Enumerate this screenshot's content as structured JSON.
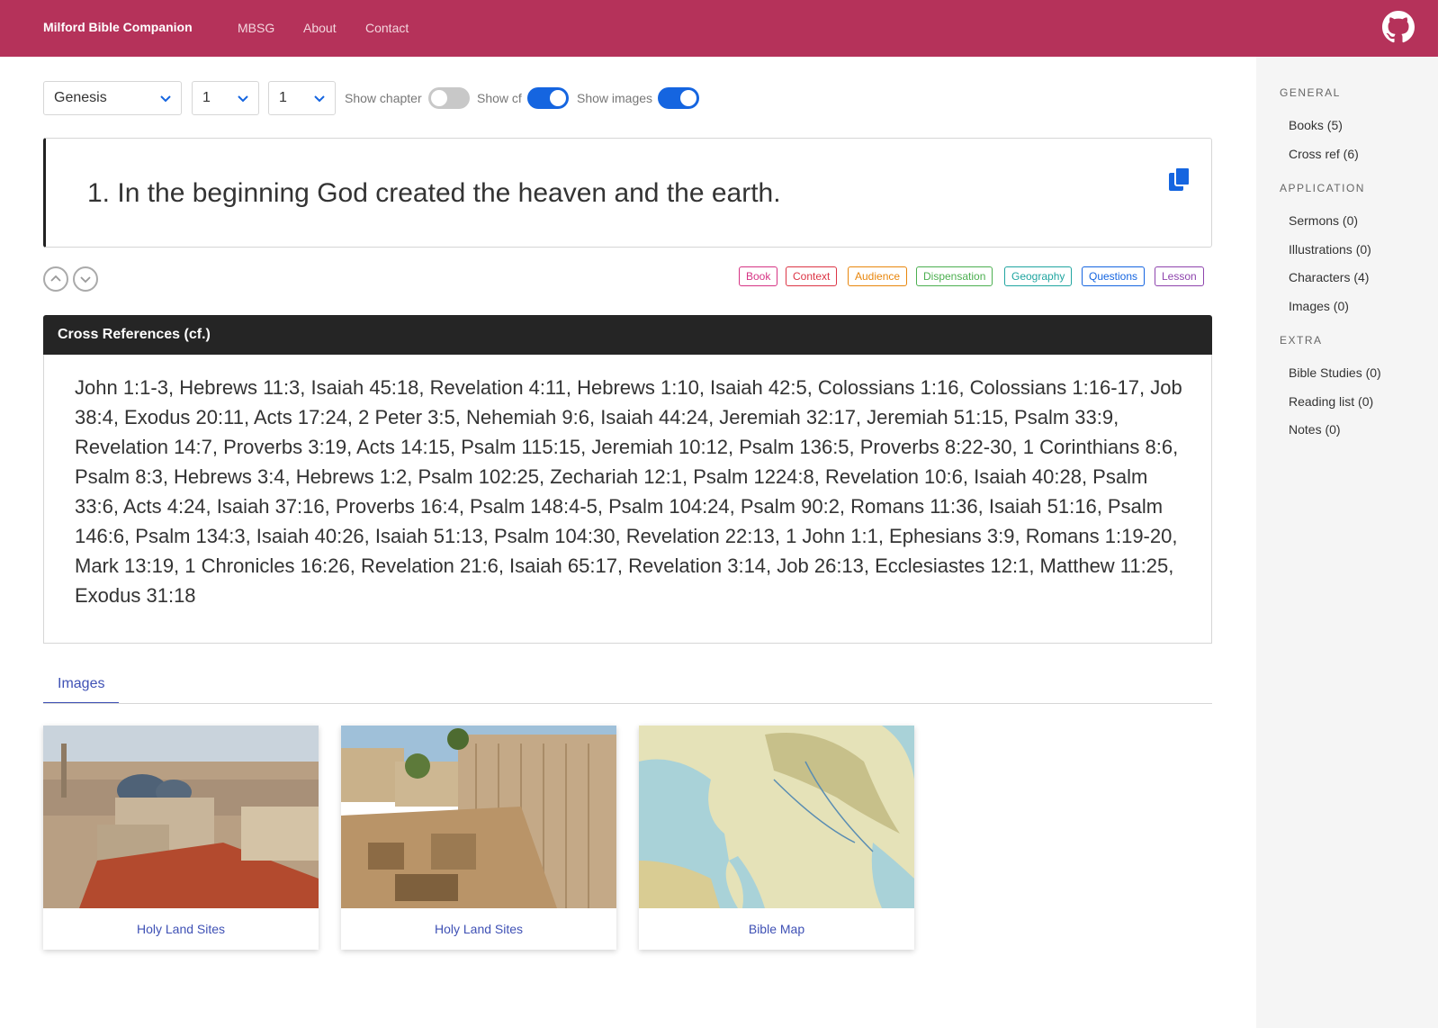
{
  "nav": {
    "brand": "Milford Bible Companion",
    "links": [
      "MBSG",
      "About",
      "Contact"
    ]
  },
  "controls": {
    "book": "Genesis",
    "chapter": "1",
    "verse": "1",
    "show_chapter_label": "Show chapter",
    "show_chapter": false,
    "show_cf_label": "Show cf",
    "show_cf": true,
    "show_images_label": "Show images",
    "show_images": true
  },
  "verse": {
    "text": "1. In the beginning God created the heaven and the earth."
  },
  "tags": [
    "Book",
    "Context",
    "Audience",
    "Dispensation",
    "Geography",
    "Questions",
    "Lesson"
  ],
  "tag_colors": [
    "#d63384",
    "#dc3545",
    "#e8860c",
    "#4caf50",
    "#20a5a0",
    "#1565e0",
    "#8e44ad"
  ],
  "cross_references": {
    "title": "Cross References (cf.)",
    "text": "John 1:1-3, Hebrews 11:3, Isaiah 45:18, Revelation 4:11, Hebrews 1:10, Isaiah 42:5, Colossians 1:16, Colossians 1:16-17, Job 38:4, Exodus 20:11, Acts 17:24, 2 Peter 3:5, Nehemiah 9:6, Isaiah 44:24, Jeremiah 32:17, Jeremiah 51:15, Psalm 33:9, Revelation 14:7, Proverbs 3:19, Acts 14:15, Psalm 115:15, Jeremiah 10:12, Psalm 136:5, Proverbs 8:22-30, 1 Corinthians 8:6, Psalm 8:3, Hebrews 3:4, Hebrews 1:2, Psalm 102:25, Zechariah 12:1, Psalm 1224:8, Revelation 10:6, Isaiah 40:28, Psalm 33:6, Acts 4:24, Isaiah 37:16, Proverbs 16:4, Psalm 148:4-5, Psalm 104:24, Psalm 90:2, Romans 11:36, Isaiah 51:16, Psalm 146:6, Psalm 134:3, Isaiah 40:26, Isaiah 51:13, Psalm 104:30, Revelation 22:13, 1 John 1:1, Ephesians 3:9, Romans 1:19-20, Mark 13:19, 1 Chronicles 16:26, Revelation 21:6, Isaiah 65:17, Revelation 3:14, Job 26:13, Ecclesiastes 12:1, Matthew 11:25, Exodus 31:18"
  },
  "images_tab": {
    "label": "Images",
    "items": [
      {
        "caption": "Holy Land Sites"
      },
      {
        "caption": "Holy Land Sites"
      },
      {
        "caption": "Bible Map"
      }
    ]
  },
  "sidebar": {
    "general_heading": "GENERAL",
    "general": [
      "Books (5)",
      "Cross ref (6)"
    ],
    "application_heading": "APPLICATION",
    "application": [
      "Sermons (0)",
      "Illustrations (0)",
      "Characters (4)",
      "Images (0)"
    ],
    "extra_heading": "EXTRA",
    "extra": [
      "Bible Studies (0)",
      "Reading list (0)",
      "Notes (0)"
    ]
  },
  "colors": {
    "navbar": "#b5325a",
    "toggle_on": "#1565e0",
    "link": "#3f51b5"
  }
}
